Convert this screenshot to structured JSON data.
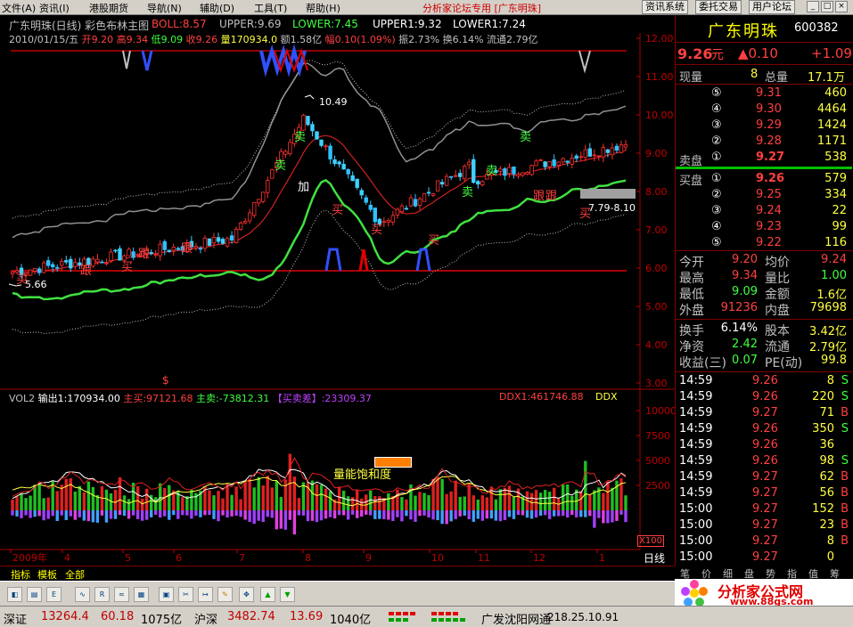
{
  "menu": {
    "items": [
      "文件(A)",
      "资讯(I)",
      "港股期货",
      "导航(N)",
      "辅助(D)",
      "工具(T)",
      "帮助(H)"
    ],
    "forum": "分析家论坛专用 [广东明珠]",
    "buttons": [
      "资讯系统",
      "委托交易",
      "用户论坛"
    ]
  },
  "chart": {
    "title": "广东明珠(日线) 彩色布林主图",
    "boll": "BOLL:8.57",
    "upper": "UPPER:9.69",
    "lower": "LOWER:7.45",
    "upper1": "UPPER1:9.32",
    "lower1": "LOWER1:7.24",
    "ohlc": {
      "date": "2010/01/15/五",
      "open": "开9.20",
      "high": "高9.34",
      "low": "低9.09",
      "close": "收9.26",
      "vol": "量170934.0",
      "amt": "额1.58亿",
      "chg": "幅0.10(1.09%)",
      "amp": "振2.73%",
      "turn": "换6.14%",
      "float": "流通2.79亿"
    },
    "price_axis": [
      "12.00",
      "11.00",
      "10.00",
      "9.00",
      "8.00",
      "7.00",
      "6.00",
      "5.00",
      "4.00",
      "3.00"
    ],
    "high_mark": "10.49",
    "low_mark": "5.66",
    "range_mark": "7.79-8.10",
    "signals": {
      "sell": "卖",
      "buy": "买",
      "follow": "跟",
      "add": "加",
      "dollar": "$"
    },
    "vol_header": {
      "name": "VOL2",
      "out": "输出1:170934.00",
      "zm": "主买:97121.68",
      "zs": "主卖:-73812.31",
      "diff": "【买卖差】:23309.37",
      "ddx1": "DDX1:461746.88",
      "ddx": "DDX"
    },
    "vol_axis": [
      "10000",
      "7500",
      "5000",
      "2500"
    ],
    "vol_unit": "X100",
    "saturation": "量能饱和度",
    "x_labels": [
      "2009年",
      "4",
      "5",
      "6",
      "7",
      "8",
      "9",
      "10",
      "11",
      "12",
      "1"
    ],
    "period": "日线"
  },
  "quote": {
    "name": "广东明珠",
    "code": "600382",
    "price": "9.26",
    "unit": "元",
    "change": "▲0.10",
    "change2": "+1.09",
    "now_vol_label": "现量",
    "now_vol": "8",
    "total_label": "总量",
    "total": "17.1万",
    "sell_label": "卖盘",
    "buy_label": "买盘",
    "asks": [
      {
        "n": "⑤",
        "p": "9.31",
        "v": "460"
      },
      {
        "n": "④",
        "p": "9.30",
        "v": "4464"
      },
      {
        "n": "③",
        "p": "9.29",
        "v": "1424"
      },
      {
        "n": "②",
        "p": "9.28",
        "v": "1171"
      },
      {
        "n": "①",
        "p": "9.27",
        "v": "538"
      }
    ],
    "bids": [
      {
        "n": "①",
        "p": "9.26",
        "v": "579"
      },
      {
        "n": "②",
        "p": "9.25",
        "v": "334"
      },
      {
        "n": "③",
        "p": "9.24",
        "v": "22"
      },
      {
        "n": "④",
        "p": "9.23",
        "v": "99"
      },
      {
        "n": "⑤",
        "p": "9.22",
        "v": "116"
      }
    ],
    "stats": [
      [
        "今开",
        "9.20",
        "均价",
        "9.24"
      ],
      [
        "最高",
        "9.34",
        "量比",
        "1.00"
      ],
      [
        "最低",
        "9.09",
        "金额",
        "1.6亿"
      ],
      [
        "外盘",
        "91236",
        "内盘",
        "79698"
      ]
    ],
    "stats2": [
      [
        "换手",
        "6.14%",
        "股本",
        "3.42亿"
      ],
      [
        "净资",
        "2.42",
        "流通",
        "2.79亿"
      ],
      [
        "收益(三)",
        "0.07",
        "PE(动)",
        "99.8"
      ]
    ],
    "ticks": [
      [
        "14:59",
        "9.26",
        "8",
        "S"
      ],
      [
        "14:59",
        "9.26",
        "220",
        "S"
      ],
      [
        "14:59",
        "9.27",
        "71",
        "B"
      ],
      [
        "14:59",
        "9.26",
        "350",
        "S"
      ],
      [
        "14:59",
        "9.26",
        "36",
        ""
      ],
      [
        "14:59",
        "9.26",
        "98",
        "S"
      ],
      [
        "14:59",
        "9.27",
        "62",
        "B"
      ],
      [
        "14:59",
        "9.27",
        "56",
        "B"
      ],
      [
        "15:00",
        "9.27",
        "152",
        "B"
      ],
      [
        "15:00",
        "9.27",
        "23",
        "B"
      ],
      [
        "15:00",
        "9.27",
        "8",
        "B"
      ],
      [
        "15:00",
        "9.27",
        "0",
        ""
      ]
    ]
  },
  "bottom": {
    "tabs": [
      "指标",
      "模板",
      "全部"
    ],
    "rtabs": [
      "笔",
      "价",
      "细",
      "盘",
      "势",
      "指",
      "值",
      "筹"
    ],
    "logo_text": "分析家公式网",
    "logo_url": "www.88gs.com",
    "status": {
      "sz": "深证",
      "sz_v": "13264.4",
      "sz_c": "60.18",
      "sz_a": "1075亿",
      "hs": "沪深",
      "hs_v": "3482.74",
      "hs_c": "13.69",
      "hs_a": "1040亿",
      "broker": "广发沈阳网通",
      "ip": "218.25.10.91"
    }
  }
}
